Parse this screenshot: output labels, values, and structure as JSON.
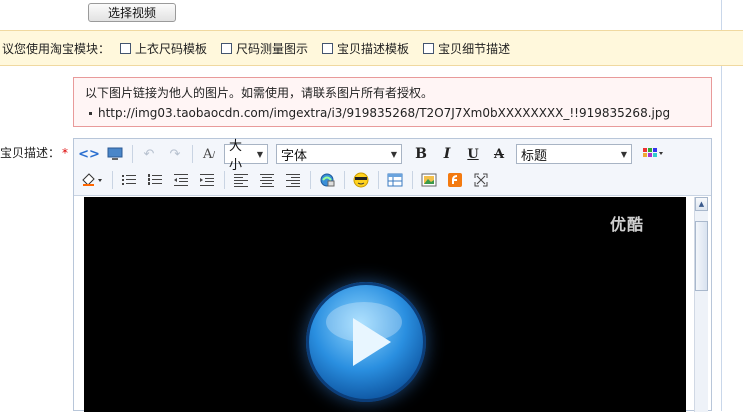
{
  "video_button": {
    "label": "选择视频"
  },
  "suggestion": {
    "label": "议您使用淘宝模块：",
    "options": [
      "上衣尺码模板",
      "尺码测量图示",
      "宝贝描述模板",
      "宝贝细节描述"
    ]
  },
  "notice": {
    "text": "以下图片链接为他人的图片。如需使用，请联系图片所有者授权。",
    "link": "http://img03.taobaocdn.com/imgextra/i3/919835268/T2O7J7Xm0bXXXXXXXX_!!919835268.jpg"
  },
  "description": {
    "label": "宝贝描述：",
    "required_mark": "*"
  },
  "toolbar": {
    "size_select": "大小",
    "font_select": "字体",
    "heading_select": "标题",
    "bold": "B",
    "italic": "I",
    "underline": "U",
    "strike": "A"
  },
  "video": {
    "watermark": "优酷"
  },
  "colors": {
    "accent": "#1f7fd8",
    "notice_border": "#e89a9a",
    "suggest_bg": "#fff8dc"
  }
}
